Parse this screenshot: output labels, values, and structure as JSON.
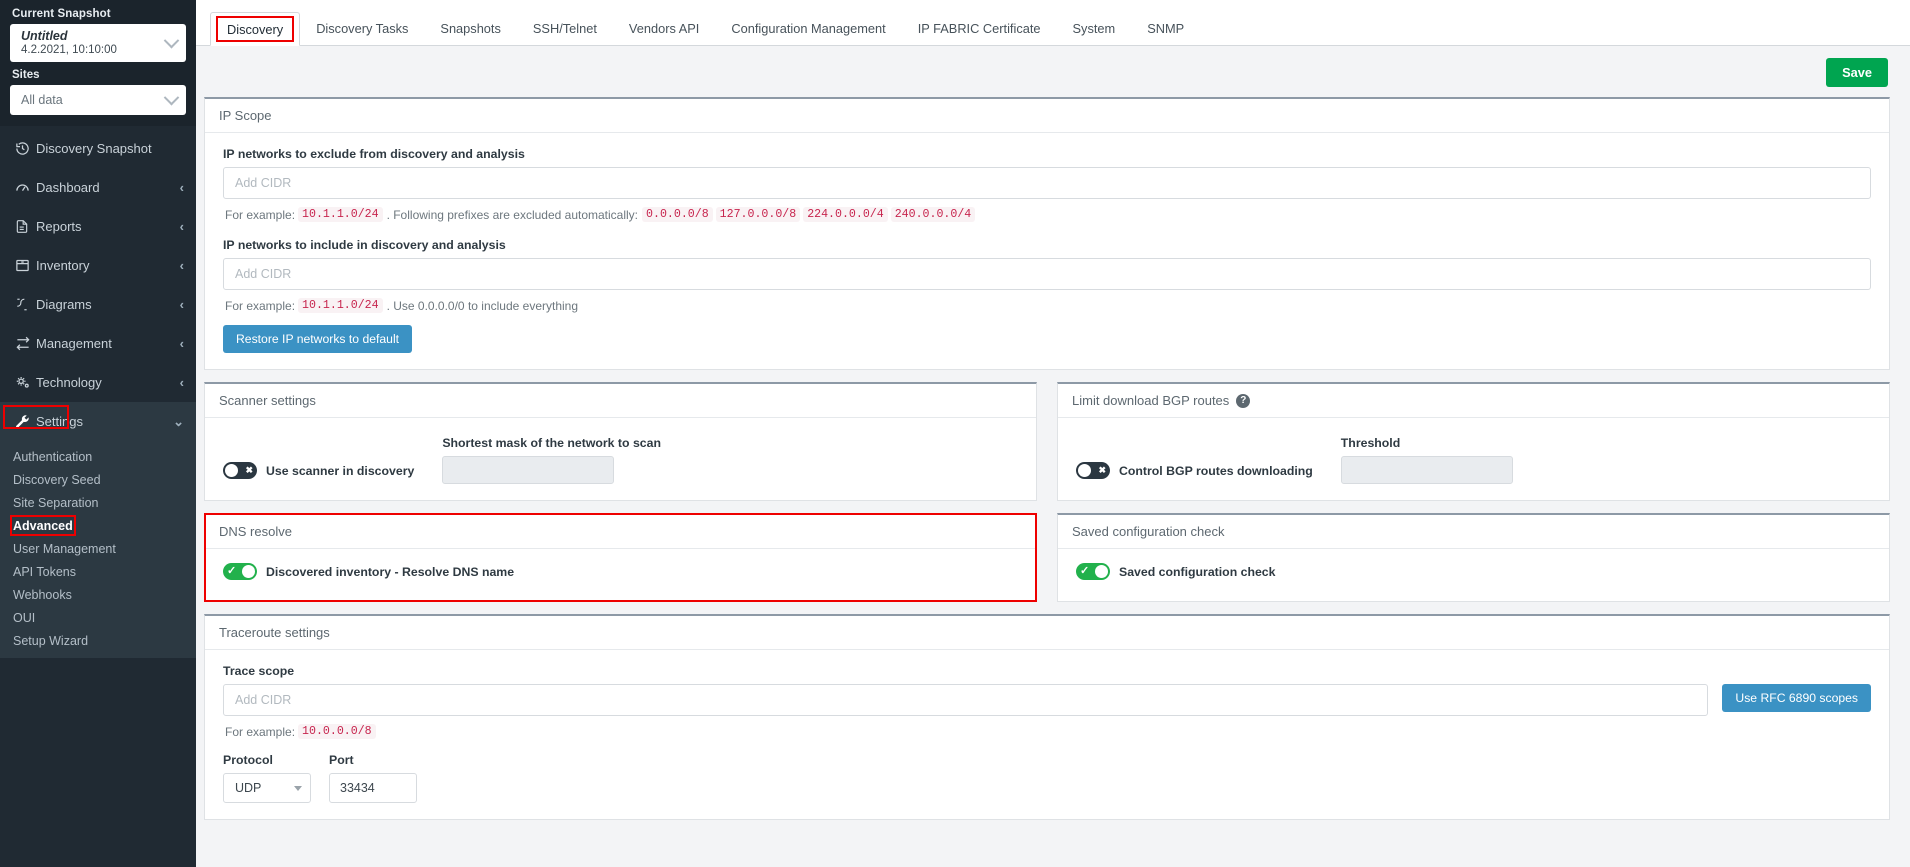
{
  "sidebar": {
    "snapshot_label": "Current Snapshot",
    "snapshot_title": "Untitled",
    "snapshot_date": "4.2.2021, 10:10:00",
    "sites_label": "Sites",
    "sites_value": "All data",
    "items": [
      {
        "label": "Discovery Snapshot",
        "icon": "history-icon",
        "chevron": ""
      },
      {
        "label": "Dashboard",
        "icon": "dashboard-icon",
        "chevron": "‹"
      },
      {
        "label": "Reports",
        "icon": "report-icon",
        "chevron": "‹"
      },
      {
        "label": "Inventory",
        "icon": "inventory-icon",
        "chevron": "‹"
      },
      {
        "label": "Diagrams",
        "icon": "diagram-icon",
        "chevron": "‹"
      },
      {
        "label": "Management",
        "icon": "management-icon",
        "chevron": "‹"
      },
      {
        "label": "Technology",
        "icon": "technology-icon",
        "chevron": "‹"
      },
      {
        "label": "Settings",
        "icon": "wrench-icon",
        "chevron": "⌄"
      }
    ],
    "settings_sub": [
      {
        "label": "Authentication"
      },
      {
        "label": "Discovery Seed"
      },
      {
        "label": "Site Separation"
      },
      {
        "label": "Advanced"
      },
      {
        "label": "User Management"
      },
      {
        "label": "API Tokens"
      },
      {
        "label": "Webhooks"
      },
      {
        "label": "OUI"
      },
      {
        "label": "Setup Wizard"
      }
    ]
  },
  "tabs": [
    {
      "label": "Discovery"
    },
    {
      "label": "Discovery Tasks"
    },
    {
      "label": "Snapshots"
    },
    {
      "label": "SSH/Telnet"
    },
    {
      "label": "Vendors API"
    },
    {
      "label": "Configuration Management"
    },
    {
      "label": "IP FABRIC Certificate"
    },
    {
      "label": "System"
    },
    {
      "label": "SNMP"
    }
  ],
  "toolbar": {
    "save_label": "Save"
  },
  "ip_scope": {
    "title": "IP Scope",
    "exclude_label": "IP networks to exclude from discovery and analysis",
    "exclude_placeholder": "Add CIDR",
    "exclude_value": "",
    "exclude_hint_prefix": "For example:",
    "exclude_hint_example": "10.1.1.0/24",
    "exclude_hint_mid": ". Following prefixes are excluded automatically:",
    "excluded_prefixes": [
      "0.0.0.0/8",
      "127.0.0.0/8",
      "224.0.0.0/4",
      "240.0.0.0/4"
    ],
    "include_label": "IP networks to include in discovery and analysis",
    "include_placeholder": "Add CIDR",
    "include_value": "",
    "include_hint_prefix": "For example:",
    "include_hint_example": "10.1.1.0/24",
    "include_hint_suffix": ". Use 0.0.0.0/0 to include everything",
    "restore_button": "Restore IP networks to default"
  },
  "scanner": {
    "title": "Scanner settings",
    "toggle_label": "Use scanner in discovery",
    "toggle_state": "off",
    "mask_label": "Shortest mask of the network to scan",
    "mask_value": ""
  },
  "bgp": {
    "title": "Limit download BGP routes",
    "help_icon": "?",
    "toggle_label": "Control BGP routes downloading",
    "toggle_state": "off",
    "threshold_label": "Threshold",
    "threshold_value": ""
  },
  "dns": {
    "title": "DNS resolve",
    "toggle_label": "Discovered inventory - Resolve DNS name",
    "toggle_state": "on"
  },
  "saved_config": {
    "title": "Saved configuration check",
    "toggle_label": "Saved configuration check",
    "toggle_state": "on"
  },
  "traceroute": {
    "title": "Traceroute settings",
    "scope_label": "Trace scope",
    "scope_placeholder": "Add CIDR",
    "scope_value": "",
    "rfc_button": "Use RFC 6890 scopes",
    "hint_prefix": "For example:",
    "hint_example": "10.0.0.0/8",
    "protocol_label": "Protocol",
    "protocol_value": "UDP",
    "port_label": "Port",
    "port_value": "33434"
  },
  "colors": {
    "accent_green": "#00a550",
    "accent_blue": "#3b92c4",
    "highlight_red": "#ee0000",
    "sidebar_bg": "#202a33",
    "toggle_on": "#22b14c"
  }
}
